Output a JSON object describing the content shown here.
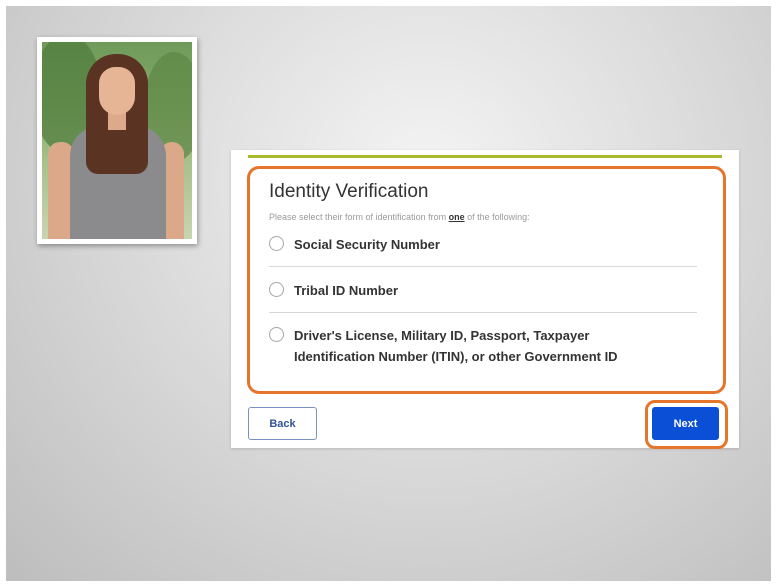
{
  "form": {
    "title": "Identity Verification",
    "instructions_prefix": "Please select their form of identification from ",
    "instructions_emphasis": "one",
    "instructions_suffix": " of the following:",
    "options": [
      {
        "label": "Social Security Number",
        "selected": false
      },
      {
        "label": "Tribal ID Number",
        "selected": false
      },
      {
        "label_line1": "Driver's License, Military ID, Passport, Taxpayer",
        "label_line2": "Identification Number (ITIN), or other Government ID",
        "selected": false
      }
    ]
  },
  "buttons": {
    "back_label": "Back",
    "next_label": "Next"
  },
  "colors": {
    "accent_rule": "#a8b92c",
    "highlight": "#e5752a",
    "primary_button": "#0b4fd6"
  }
}
